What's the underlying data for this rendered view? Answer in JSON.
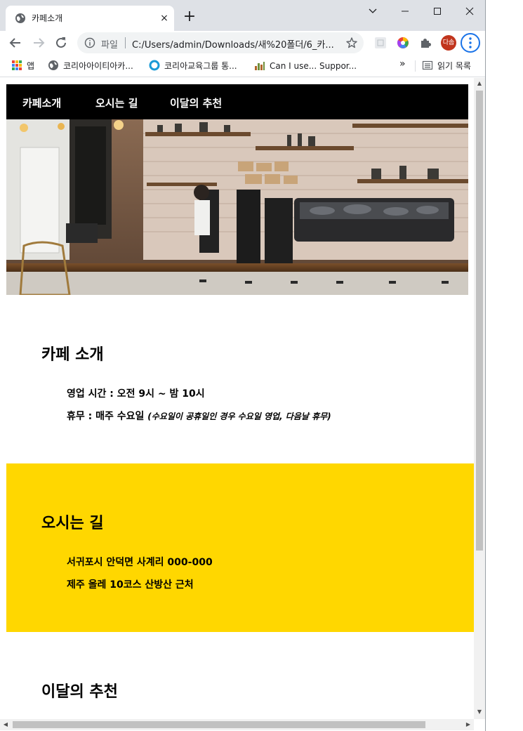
{
  "browser": {
    "tab": {
      "title": "카페소개",
      "close_icon": "×"
    },
    "new_tab_icon": "+",
    "window_controls": {
      "minimize": "—",
      "maximize": "☐",
      "close": "✕",
      "tab_search": "⌄"
    },
    "address": {
      "security_label": "파일",
      "url": "C:/Users/admin/Downloads/새%20폴더/6_카..."
    },
    "profile_initials": "다솜",
    "bookmarks": {
      "apps_label": "앱",
      "items": [
        "코리아아이티아카...",
        "코리아교육그룹 통...",
        "Can I use... Suppor..."
      ],
      "overflow": "»",
      "reading_list": "읽기 목록"
    }
  },
  "site": {
    "nav": [
      "카페소개",
      "오시는 길",
      "이달의 추천"
    ],
    "about": {
      "title": "카페 소개",
      "hours": "영업 시간 : 오전 9시 ~ 밤 10시",
      "closed": "휴무 : 매주 수요일",
      "closed_note": "(수요일이 공휴일인 경우 수요일 영업, 다음날 휴무)"
    },
    "directions": {
      "title": "오시는 길",
      "address": "서귀포시 안덕면 사계리 000-000",
      "landmark": "제주 올레 10코스 산방산 근처",
      "background": "#ffd700"
    },
    "recommend": {
      "title": "이달의 추천"
    }
  }
}
